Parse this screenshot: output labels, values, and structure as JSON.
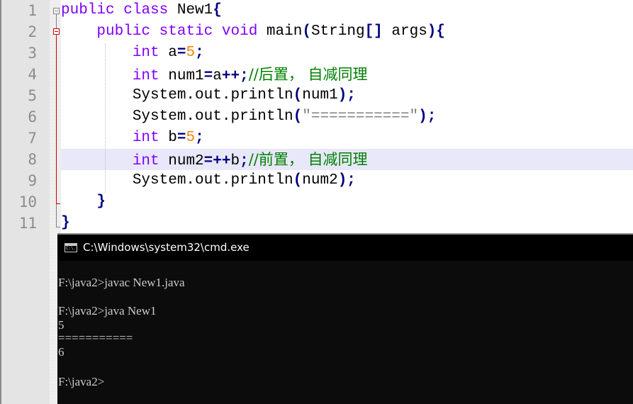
{
  "editor": {
    "line_numbers": [
      "1",
      "2",
      "3",
      "4",
      "5",
      "6",
      "7",
      "8",
      "9",
      "10",
      "11"
    ],
    "highlighted_line": 8,
    "lines": [
      [
        {
          "c": "kw",
          "t": "public"
        },
        {
          "c": "id",
          "t": " "
        },
        {
          "c": "kw",
          "t": "class"
        },
        {
          "c": "id",
          "t": " New1"
        },
        {
          "c": "op",
          "t": "{"
        }
      ],
      [
        {
          "c": "id",
          "t": "    "
        },
        {
          "c": "kw",
          "t": "public"
        },
        {
          "c": "id",
          "t": " "
        },
        {
          "c": "kw",
          "t": "static"
        },
        {
          "c": "id",
          "t": " "
        },
        {
          "c": "kw",
          "t": "void"
        },
        {
          "c": "id",
          "t": " main"
        },
        {
          "c": "op",
          "t": "("
        },
        {
          "c": "id",
          "t": "String"
        },
        {
          "c": "op",
          "t": "[]"
        },
        {
          "c": "id",
          "t": " args"
        },
        {
          "c": "op",
          "t": "){"
        }
      ],
      [
        {
          "c": "id",
          "t": "        "
        },
        {
          "c": "ty",
          "t": "int"
        },
        {
          "c": "id",
          "t": " a"
        },
        {
          "c": "op",
          "t": "="
        },
        {
          "c": "num",
          "t": "5"
        },
        {
          "c": "op",
          "t": ";"
        }
      ],
      [
        {
          "c": "id",
          "t": "        "
        },
        {
          "c": "ty",
          "t": "int"
        },
        {
          "c": "id",
          "t": " num1"
        },
        {
          "c": "op",
          "t": "="
        },
        {
          "c": "id",
          "t": "a"
        },
        {
          "c": "op",
          "t": "++;"
        },
        {
          "c": "cmt",
          "t": "//后置， 自减同理"
        }
      ],
      [
        {
          "c": "id",
          "t": "        System.out.println"
        },
        {
          "c": "op",
          "t": "("
        },
        {
          "c": "id",
          "t": "num1"
        },
        {
          "c": "op",
          "t": ");"
        }
      ],
      [
        {
          "c": "id",
          "t": "        System.out.println"
        },
        {
          "c": "op",
          "t": "("
        },
        {
          "c": "str",
          "t": "\"===========\""
        },
        {
          "c": "op",
          "t": ");"
        }
      ],
      [
        {
          "c": "id",
          "t": "        "
        },
        {
          "c": "ty",
          "t": "int"
        },
        {
          "c": "id",
          "t": " b"
        },
        {
          "c": "op",
          "t": "="
        },
        {
          "c": "num",
          "t": "5"
        },
        {
          "c": "op",
          "t": ";"
        }
      ],
      [
        {
          "c": "id",
          "t": "        "
        },
        {
          "c": "ty",
          "t": "int"
        },
        {
          "c": "id",
          "t": " num2"
        },
        {
          "c": "op",
          "t": "=++"
        },
        {
          "c": "id",
          "t": "b"
        },
        {
          "c": "op",
          "t": ";"
        },
        {
          "c": "cmt",
          "t": "//前置， 自减同理"
        }
      ],
      [
        {
          "c": "id",
          "t": "        System.out.println"
        },
        {
          "c": "op",
          "t": "("
        },
        {
          "c": "id",
          "t": "num2"
        },
        {
          "c": "op",
          "t": ");"
        }
      ],
      [
        {
          "c": "id",
          "t": "    "
        },
        {
          "c": "op",
          "t": "}"
        }
      ],
      [
        {
          "c": "op",
          "t": "}"
        }
      ]
    ]
  },
  "cmd": {
    "title": "C:\\Windows\\system32\\cmd.exe",
    "icon_label": "C:\\.",
    "output_lines": [
      "",
      "F:\\java2>javac New1.java",
      "",
      "F:\\java2>java New1",
      "5",
      "===========",
      "6",
      "",
      "F:\\java2>"
    ]
  }
}
